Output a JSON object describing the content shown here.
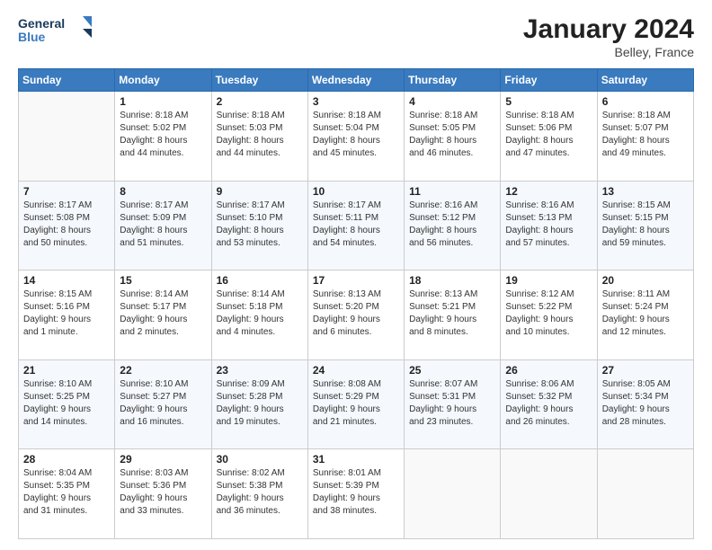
{
  "header": {
    "logo_line1": "General",
    "logo_line2": "Blue",
    "month_title": "January 2024",
    "location": "Belley, France"
  },
  "weekdays": [
    "Sunday",
    "Monday",
    "Tuesday",
    "Wednesday",
    "Thursday",
    "Friday",
    "Saturday"
  ],
  "weeks": [
    [
      {
        "day": "",
        "info": ""
      },
      {
        "day": "1",
        "info": "Sunrise: 8:18 AM\nSunset: 5:02 PM\nDaylight: 8 hours\nand 44 minutes."
      },
      {
        "day": "2",
        "info": "Sunrise: 8:18 AM\nSunset: 5:03 PM\nDaylight: 8 hours\nand 44 minutes."
      },
      {
        "day": "3",
        "info": "Sunrise: 8:18 AM\nSunset: 5:04 PM\nDaylight: 8 hours\nand 45 minutes."
      },
      {
        "day": "4",
        "info": "Sunrise: 8:18 AM\nSunset: 5:05 PM\nDaylight: 8 hours\nand 46 minutes."
      },
      {
        "day": "5",
        "info": "Sunrise: 8:18 AM\nSunset: 5:06 PM\nDaylight: 8 hours\nand 47 minutes."
      },
      {
        "day": "6",
        "info": "Sunrise: 8:18 AM\nSunset: 5:07 PM\nDaylight: 8 hours\nand 49 minutes."
      }
    ],
    [
      {
        "day": "7",
        "info": "Sunrise: 8:17 AM\nSunset: 5:08 PM\nDaylight: 8 hours\nand 50 minutes."
      },
      {
        "day": "8",
        "info": "Sunrise: 8:17 AM\nSunset: 5:09 PM\nDaylight: 8 hours\nand 51 minutes."
      },
      {
        "day": "9",
        "info": "Sunrise: 8:17 AM\nSunset: 5:10 PM\nDaylight: 8 hours\nand 53 minutes."
      },
      {
        "day": "10",
        "info": "Sunrise: 8:17 AM\nSunset: 5:11 PM\nDaylight: 8 hours\nand 54 minutes."
      },
      {
        "day": "11",
        "info": "Sunrise: 8:16 AM\nSunset: 5:12 PM\nDaylight: 8 hours\nand 56 minutes."
      },
      {
        "day": "12",
        "info": "Sunrise: 8:16 AM\nSunset: 5:13 PM\nDaylight: 8 hours\nand 57 minutes."
      },
      {
        "day": "13",
        "info": "Sunrise: 8:15 AM\nSunset: 5:15 PM\nDaylight: 8 hours\nand 59 minutes."
      }
    ],
    [
      {
        "day": "14",
        "info": "Sunrise: 8:15 AM\nSunset: 5:16 PM\nDaylight: 9 hours\nand 1 minute."
      },
      {
        "day": "15",
        "info": "Sunrise: 8:14 AM\nSunset: 5:17 PM\nDaylight: 9 hours\nand 2 minutes."
      },
      {
        "day": "16",
        "info": "Sunrise: 8:14 AM\nSunset: 5:18 PM\nDaylight: 9 hours\nand 4 minutes."
      },
      {
        "day": "17",
        "info": "Sunrise: 8:13 AM\nSunset: 5:20 PM\nDaylight: 9 hours\nand 6 minutes."
      },
      {
        "day": "18",
        "info": "Sunrise: 8:13 AM\nSunset: 5:21 PM\nDaylight: 9 hours\nand 8 minutes."
      },
      {
        "day": "19",
        "info": "Sunrise: 8:12 AM\nSunset: 5:22 PM\nDaylight: 9 hours\nand 10 minutes."
      },
      {
        "day": "20",
        "info": "Sunrise: 8:11 AM\nSunset: 5:24 PM\nDaylight: 9 hours\nand 12 minutes."
      }
    ],
    [
      {
        "day": "21",
        "info": "Sunrise: 8:10 AM\nSunset: 5:25 PM\nDaylight: 9 hours\nand 14 minutes."
      },
      {
        "day": "22",
        "info": "Sunrise: 8:10 AM\nSunset: 5:27 PM\nDaylight: 9 hours\nand 16 minutes."
      },
      {
        "day": "23",
        "info": "Sunrise: 8:09 AM\nSunset: 5:28 PM\nDaylight: 9 hours\nand 19 minutes."
      },
      {
        "day": "24",
        "info": "Sunrise: 8:08 AM\nSunset: 5:29 PM\nDaylight: 9 hours\nand 21 minutes."
      },
      {
        "day": "25",
        "info": "Sunrise: 8:07 AM\nSunset: 5:31 PM\nDaylight: 9 hours\nand 23 minutes."
      },
      {
        "day": "26",
        "info": "Sunrise: 8:06 AM\nSunset: 5:32 PM\nDaylight: 9 hours\nand 26 minutes."
      },
      {
        "day": "27",
        "info": "Sunrise: 8:05 AM\nSunset: 5:34 PM\nDaylight: 9 hours\nand 28 minutes."
      }
    ],
    [
      {
        "day": "28",
        "info": "Sunrise: 8:04 AM\nSunset: 5:35 PM\nDaylight: 9 hours\nand 31 minutes."
      },
      {
        "day": "29",
        "info": "Sunrise: 8:03 AM\nSunset: 5:36 PM\nDaylight: 9 hours\nand 33 minutes."
      },
      {
        "day": "30",
        "info": "Sunrise: 8:02 AM\nSunset: 5:38 PM\nDaylight: 9 hours\nand 36 minutes."
      },
      {
        "day": "31",
        "info": "Sunrise: 8:01 AM\nSunset: 5:39 PM\nDaylight: 9 hours\nand 38 minutes."
      },
      {
        "day": "",
        "info": ""
      },
      {
        "day": "",
        "info": ""
      },
      {
        "day": "",
        "info": ""
      }
    ]
  ]
}
